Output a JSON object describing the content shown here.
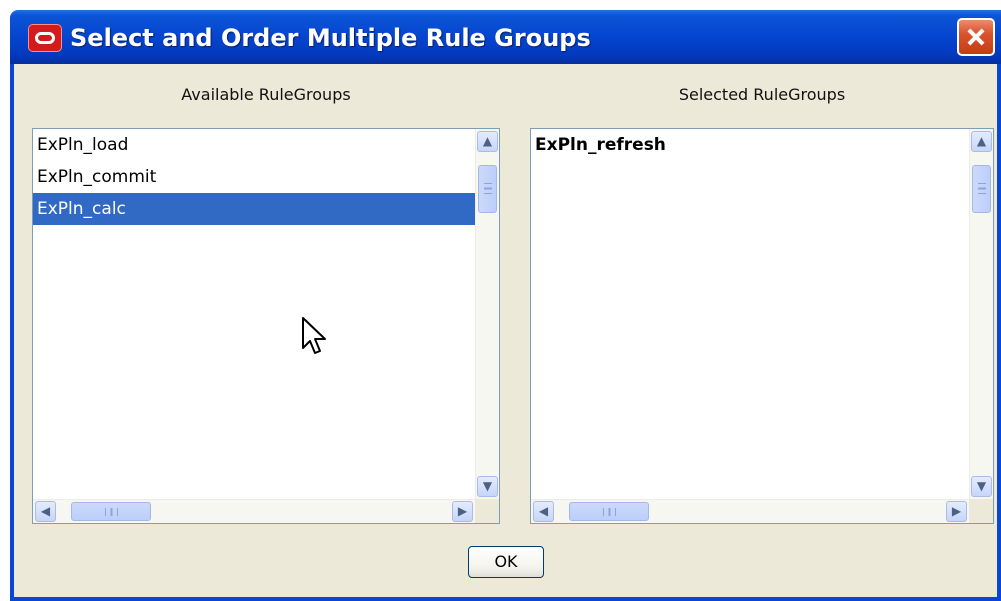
{
  "window": {
    "title": "Select and Order Multiple Rule Groups",
    "icon": "oracle-logo-icon",
    "close_icon": "close-icon"
  },
  "available": {
    "label": "Available RuleGroups",
    "items": [
      "ExPln_load",
      "ExPln_commit",
      "ExPln_calc"
    ],
    "selected_index": 2
  },
  "selected": {
    "label": "Selected RuleGroups",
    "items": [
      "ExPln_refresh"
    ]
  },
  "buttons": {
    "ok_label": "OK"
  },
  "colors": {
    "titlebar": "#0545cf",
    "selection": "#316ac5",
    "dialog_bg": "#ece9d8",
    "close_button": "#d9542e"
  }
}
